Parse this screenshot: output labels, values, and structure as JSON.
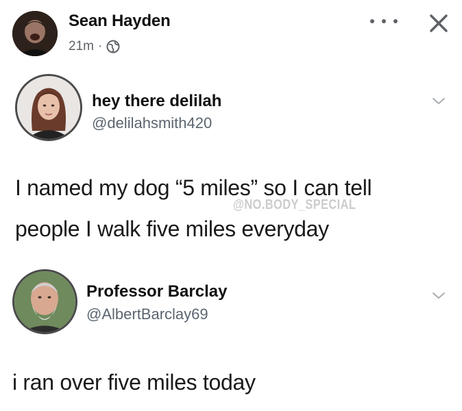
{
  "post": {
    "author": "Sean Hayden",
    "time": "21m",
    "separator": "·",
    "menu_icon": "more-horizontal-icon",
    "close_icon": "close-icon",
    "privacy_icon": "globe-icon"
  },
  "tweet": {
    "name": "hey there delilah",
    "handle": "@delilahsmith420",
    "body_line1": "I named my dog “5 miles” so I can tell",
    "body_line2": "people I walk five miles everyday",
    "watermark": "@NO.BODY_SPECIAL"
  },
  "reply": {
    "name": "Professor Barclay",
    "handle": "@AlbertBarclay69",
    "body": "i ran over five miles today"
  },
  "colors": {
    "text": "#1c1c1c",
    "muted": "#5e6166",
    "handle": "#5b6570",
    "background": "#ffffff"
  }
}
